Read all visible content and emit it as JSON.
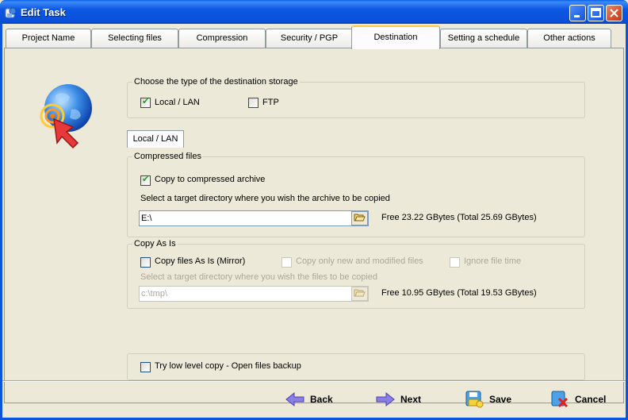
{
  "window": {
    "title": "Edit Task"
  },
  "tabs": [
    {
      "label": "Project Name"
    },
    {
      "label": "Selecting files"
    },
    {
      "label": "Compression"
    },
    {
      "label": "Security / PGP"
    },
    {
      "label": "Destination",
      "active": true
    },
    {
      "label": "Setting a schedule"
    },
    {
      "label": "Other actions"
    }
  ],
  "storage": {
    "group_label": "Choose the type of the destination storage",
    "local_label": "Local / LAN",
    "local_checked": true,
    "ftp_label": "FTP",
    "ftp_checked": false
  },
  "subtab_label": "Local / LAN",
  "compressed": {
    "group_label": "Compressed files",
    "copy_label": "Copy to compressed archive",
    "copy_checked": true,
    "instruction": "Select a target directory where you wish the archive to be copied",
    "path": "E:\\",
    "free_text": "Free 23.22 GBytes (Total 25.69 GBytes)"
  },
  "copy_as_is": {
    "group_label": "Copy As Is",
    "mirror_label": "Copy files As Is (Mirror)",
    "mirror_checked": false,
    "new_modified_label": "Copy only new and modified files",
    "ignore_time_label": "Ignore file time",
    "instruction": "Select a target directory where you wish the files to be copied",
    "path": "c:\\tmp\\",
    "free_text": "Free 10.95 GBytes (Total 19.53 GBytes)"
  },
  "low_level": {
    "label": "Try low level copy -  Open files backup",
    "checked": false
  },
  "buttons": {
    "back": "Back",
    "next": "Next",
    "save": "Save",
    "cancel": "Cancel"
  },
  "colors": {
    "titlebar": "#0a55e0",
    "face": "#ece9d8",
    "active_tab_accent": "#ffc83c",
    "check_green": "#21a121"
  }
}
